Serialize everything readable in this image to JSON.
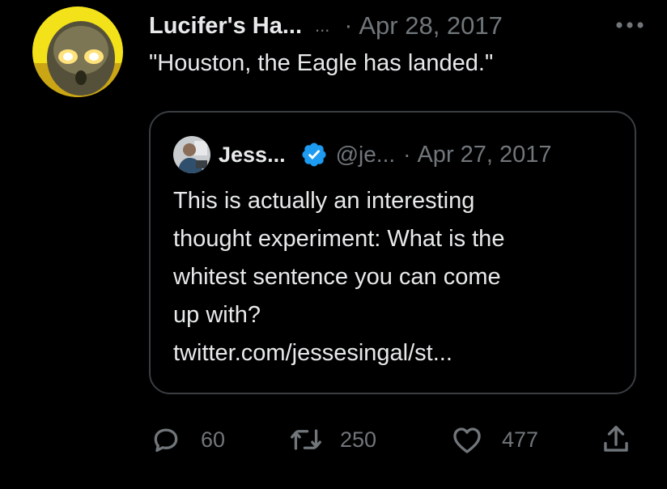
{
  "tweet": {
    "display_name": "Lucifer's Ha...",
    "ellipsis": "...",
    "separator": "·",
    "date": "Apr 28, 2017",
    "more_label": "•••",
    "text": "\"Houston, the Eagle has landed.\""
  },
  "quote": {
    "name": "Jess...",
    "handle": "@je...",
    "separator": "·",
    "date": "Apr 27, 2017",
    "lines": [
      "This is actually an interesting",
      "thought experiment: What is the",
      "whitest sentence you can come",
      "up with?",
      "twitter.com/jessesingal/st..."
    ]
  },
  "actions": {
    "reply_count": "60",
    "retweet_count": "250",
    "like_count": "477"
  },
  "colors": {
    "background": "#000000",
    "primary_text": "#e7e9ea",
    "secondary_text": "#71767b",
    "border": "#3a3e42",
    "verified_blue": "#1d9bf0",
    "avatar_yellow": "#f3e21a"
  },
  "icons": {
    "avatar": "avatar-glowing-eyes",
    "more": "more-dots-icon",
    "verified": "verified-badge-icon",
    "reply": "reply-icon",
    "retweet": "retweet-icon",
    "like": "heart-icon",
    "share": "share-icon"
  }
}
